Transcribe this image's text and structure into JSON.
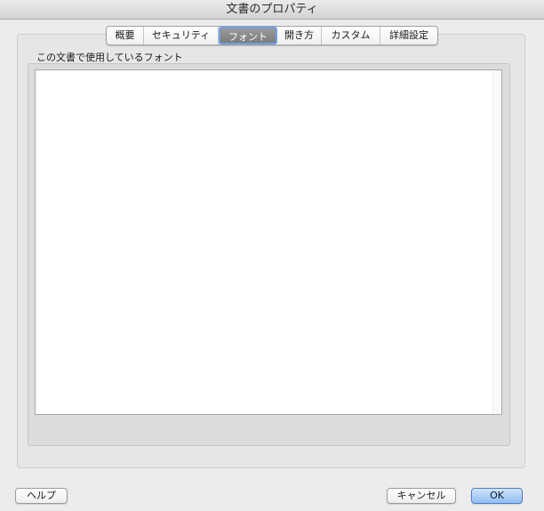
{
  "window": {
    "title": "文書のプロパティ"
  },
  "tabs": [
    {
      "label": "概要",
      "active": false
    },
    {
      "label": "セキュリティ",
      "active": false
    },
    {
      "label": "フォント",
      "active": true
    },
    {
      "label": "開き方",
      "active": false
    },
    {
      "label": "カスタム",
      "active": false
    },
    {
      "label": "詳細設定",
      "active": false
    }
  ],
  "fonts_panel": {
    "label": "この文書で使用しているフォント",
    "items": []
  },
  "buttons": {
    "help": "ヘルプ",
    "cancel": "キャンセル",
    "ok": "OK"
  },
  "colors": {
    "active_tab": "#8a8a8a",
    "focus_ring": "#6ea0e6",
    "default_button": "#8fbef2"
  }
}
